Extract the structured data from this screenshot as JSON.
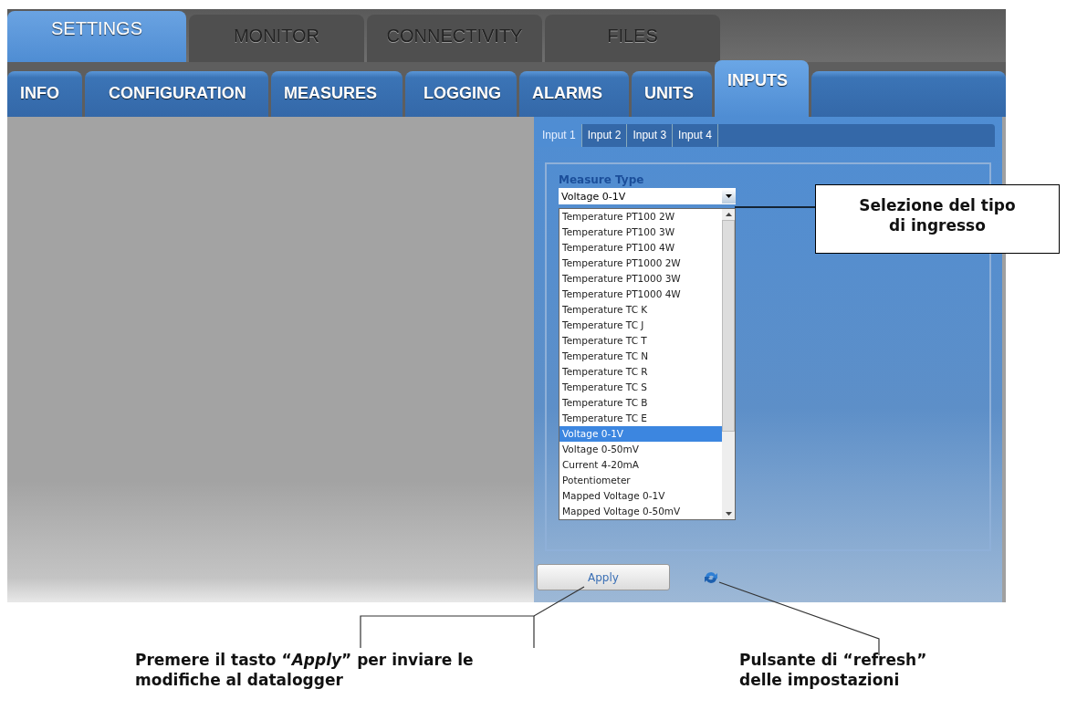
{
  "main_tabs": [
    {
      "label": "SETTINGS",
      "selected": true
    },
    {
      "label": "MONITOR",
      "selected": false
    },
    {
      "label": "CONNECTIVITY",
      "selected": false
    },
    {
      "label": "FILES",
      "selected": false
    }
  ],
  "sub_tabs": [
    {
      "label": "INFO",
      "selected": false
    },
    {
      "label": "CONFIGURATION",
      "selected": false
    },
    {
      "label": "MEASURES",
      "selected": false
    },
    {
      "label": "LOGGING",
      "selected": false
    },
    {
      "label": "ALARMS",
      "selected": false
    },
    {
      "label": "UNITS",
      "selected": false
    },
    {
      "label": "INPUTS",
      "selected": true
    }
  ],
  "input_tabs": [
    {
      "label": "Input 1",
      "selected": true
    },
    {
      "label": "Input 2",
      "selected": false
    },
    {
      "label": "Input 3",
      "selected": false
    },
    {
      "label": "Input 4",
      "selected": false
    }
  ],
  "measure_type": {
    "label": "Measure Type",
    "value": "Voltage 0-1V",
    "options": [
      {
        "label": "Temperature PT100 2W",
        "selected": false
      },
      {
        "label": "Temperature PT100 3W",
        "selected": false
      },
      {
        "label": "Temperature PT100 4W",
        "selected": false
      },
      {
        "label": "Temperature PT1000 2W",
        "selected": false
      },
      {
        "label": "Temperature PT1000 3W",
        "selected": false
      },
      {
        "label": "Temperature PT1000 4W",
        "selected": false
      },
      {
        "label": "Temperature TC K",
        "selected": false
      },
      {
        "label": "Temperature TC J",
        "selected": false
      },
      {
        "label": "Temperature TC T",
        "selected": false
      },
      {
        "label": "Temperature TC N",
        "selected": false
      },
      {
        "label": "Temperature TC R",
        "selected": false
      },
      {
        "label": "Temperature TC S",
        "selected": false
      },
      {
        "label": "Temperature TC B",
        "selected": false
      },
      {
        "label": "Temperature TC E",
        "selected": false
      },
      {
        "label": "Voltage 0-1V",
        "selected": true
      },
      {
        "label": "Voltage 0-50mV",
        "selected": false
      },
      {
        "label": "Current 4-20mA",
        "selected": false
      },
      {
        "label": "Potentiometer",
        "selected": false
      },
      {
        "label": "Mapped Voltage 0-1V",
        "selected": false
      },
      {
        "label": "Mapped Voltage 0-50mV",
        "selected": false
      }
    ]
  },
  "apply_button": "Apply",
  "annotations": [
    {
      "kind": "box",
      "text": "Selezione del tipo di ingresso"
    },
    {
      "kind": "plain",
      "text": "Premere il tasto “*Apply*” per inviare le modifiche al datalogger"
    },
    {
      "kind": "plain",
      "text": "Pulsante di “refresh” delle impostazioni"
    }
  ]
}
